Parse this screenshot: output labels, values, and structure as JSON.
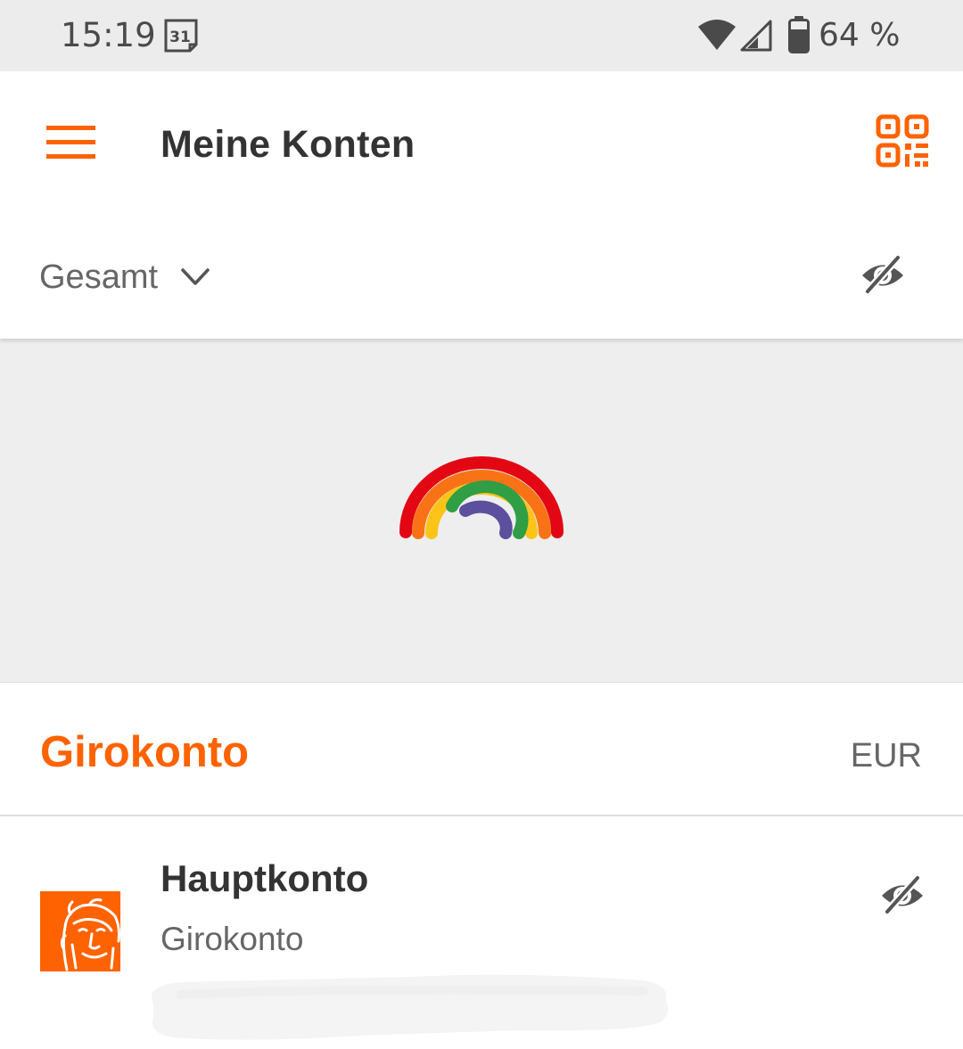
{
  "status_bar": {
    "time": "15:19",
    "calendar_day": "31",
    "battery_text": "64 %"
  },
  "header": {
    "title": "Meine Konten",
    "total_label": "Gesamt"
  },
  "section": {
    "title": "Girokonto",
    "currency": "EUR"
  },
  "account": {
    "name": "Hauptkonto",
    "type": "Girokonto"
  },
  "colors": {
    "accent": "#ff6200",
    "status_bar_bg": "#ececec",
    "banner_bg": "#eeeeee",
    "text_primary": "#333333",
    "text_secondary": "#666666",
    "rainbow": [
      "#e30613",
      "#f97316",
      "#fcc419",
      "#2f9e44",
      "#5b4f9e"
    ]
  },
  "icons": {
    "menu": "hamburger-menu-icon",
    "qr": "qr-code-icon",
    "visibility": "eye-slash-icon",
    "dropdown": "chevron-down-icon",
    "banner": "rainbow-icon",
    "bank_logo": "ing-lion-logo"
  }
}
